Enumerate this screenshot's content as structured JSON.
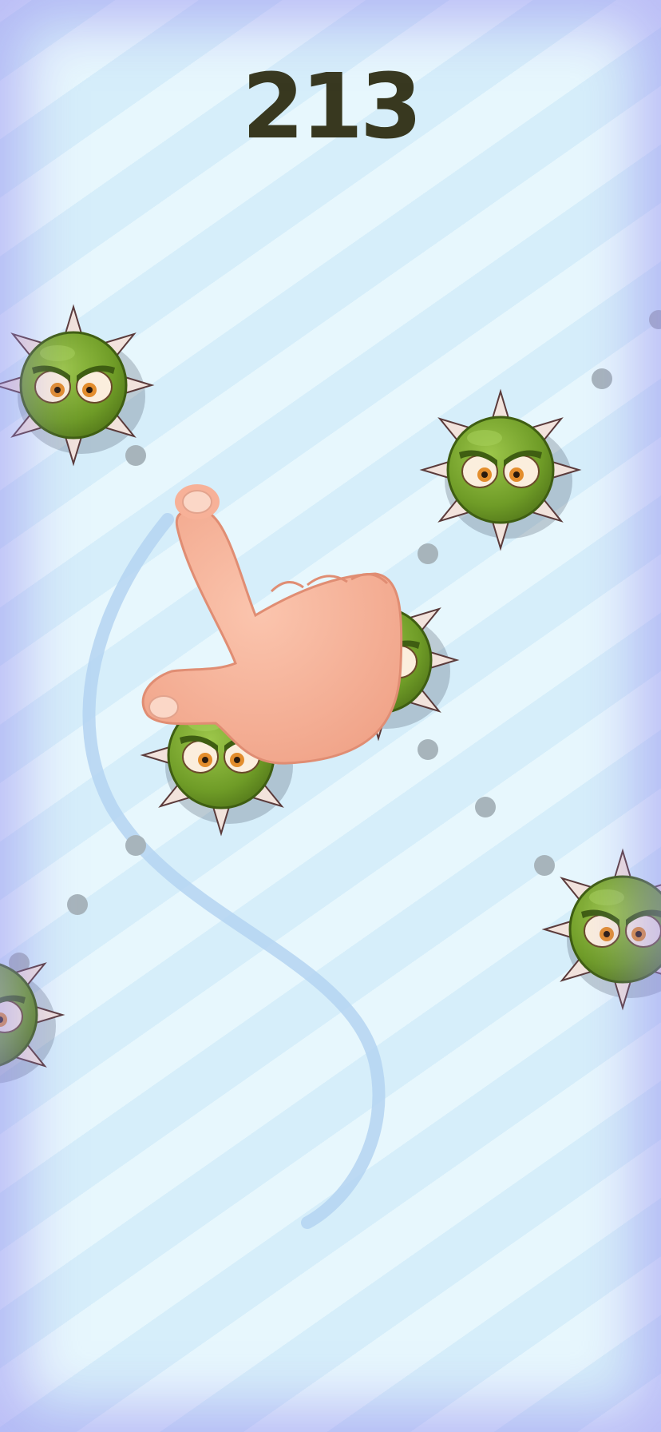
{
  "game": {
    "score": "213",
    "colors": {
      "background_light": "#e7f7fd",
      "background_stripe": "#d6eefa",
      "score_text": "#38381f",
      "enemy_body": "#74a22c",
      "enemy_spike": "#f2e3dc",
      "pellet": "#a7b4bb",
      "finger": "#f7b198",
      "trail": "#b4d3f1"
    },
    "elements": {
      "enemy_icon": "spiky-green-mine-icon",
      "pointer_icon": "pointing-hand-icon",
      "trail_icon": "swipe-trail-icon",
      "pellet_icon": "gray-dot-icon"
    }
  }
}
